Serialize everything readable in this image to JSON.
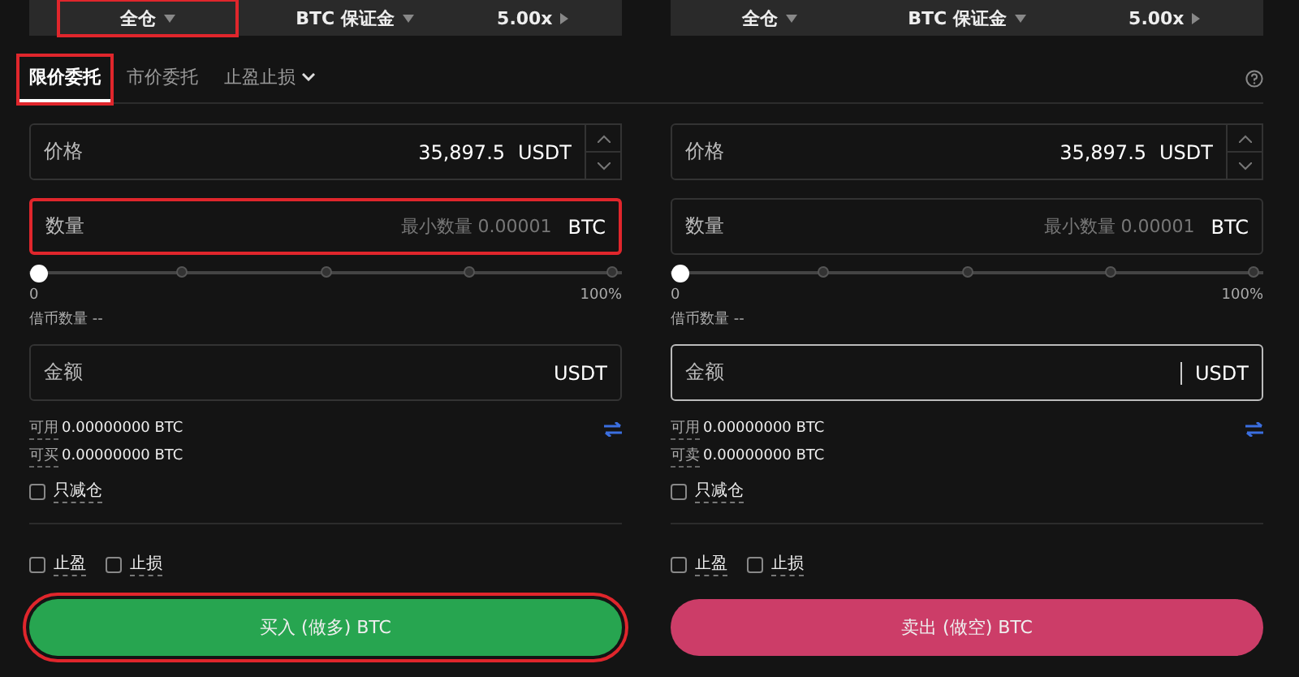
{
  "order_tabs": [
    {
      "label": "限价委托",
      "selected": true,
      "highlighted": true,
      "kind": "plain"
    },
    {
      "label": "市价委托",
      "selected": false,
      "highlighted": false,
      "kind": "plain"
    },
    {
      "label": "止盈止损",
      "selected": false,
      "highlighted": false,
      "kind": "dropdown"
    }
  ],
  "panels": [
    {
      "kind": "buy",
      "margin_bar": [
        {
          "label": "全仓",
          "kind": "dropdown",
          "highlighted": true
        },
        {
          "label": "BTC 保证金",
          "kind": "dropdown",
          "highlighted": false
        },
        {
          "label": "5.00x",
          "kind": "stepper",
          "highlighted": false
        }
      ],
      "price": {
        "label": "价格",
        "value": "35,897.5",
        "unit": "USDT"
      },
      "quantity": {
        "label": "数量",
        "placeholder": "最小数量 0.00001",
        "unit": "BTC",
        "highlighted": true
      },
      "slider": {
        "level": 0,
        "min_label": "0",
        "max_label": "100%"
      },
      "borrow": {
        "label": "借币数量",
        "value": "--"
      },
      "amount": {
        "label": "金额",
        "unit": "USDT",
        "focused": false
      },
      "balances": [
        {
          "label": "可用",
          "value": "0.00000000 BTC"
        },
        {
          "label": "可买",
          "value": "0.00000000 BTC"
        }
      ],
      "reduce_only": {
        "label": "只减仓",
        "checked": false
      },
      "tpsl": [
        {
          "label": "止盈",
          "checked": false
        },
        {
          "label": "止损",
          "checked": false
        }
      ],
      "submit": {
        "label": "买入 (做多) BTC",
        "highlighted": true
      }
    },
    {
      "kind": "sell",
      "margin_bar": [
        {
          "label": "全仓",
          "kind": "dropdown",
          "highlighted": false
        },
        {
          "label": "BTC 保证金",
          "kind": "dropdown",
          "highlighted": false
        },
        {
          "label": "5.00x",
          "kind": "stepper",
          "highlighted": false
        }
      ],
      "price": {
        "label": "价格",
        "value": "35,897.5",
        "unit": "USDT"
      },
      "quantity": {
        "label": "数量",
        "placeholder": "最小数量 0.00001",
        "unit": "BTC",
        "highlighted": false
      },
      "slider": {
        "level": 0,
        "min_label": "0",
        "max_label": "100%"
      },
      "borrow": {
        "label": "借币数量",
        "value": "--"
      },
      "amount": {
        "label": "金额",
        "unit": "USDT",
        "focused": true
      },
      "balances": [
        {
          "label": "可用",
          "value": "0.00000000 BTC"
        },
        {
          "label": "可卖",
          "value": "0.00000000 BTC"
        }
      ],
      "reduce_only": {
        "label": "只减仓",
        "checked": false
      },
      "tpsl": [
        {
          "label": "止盈",
          "checked": false
        },
        {
          "label": "止损",
          "checked": false
        }
      ],
      "submit": {
        "label": "卖出 (做空) BTC",
        "highlighted": false
      }
    }
  ]
}
